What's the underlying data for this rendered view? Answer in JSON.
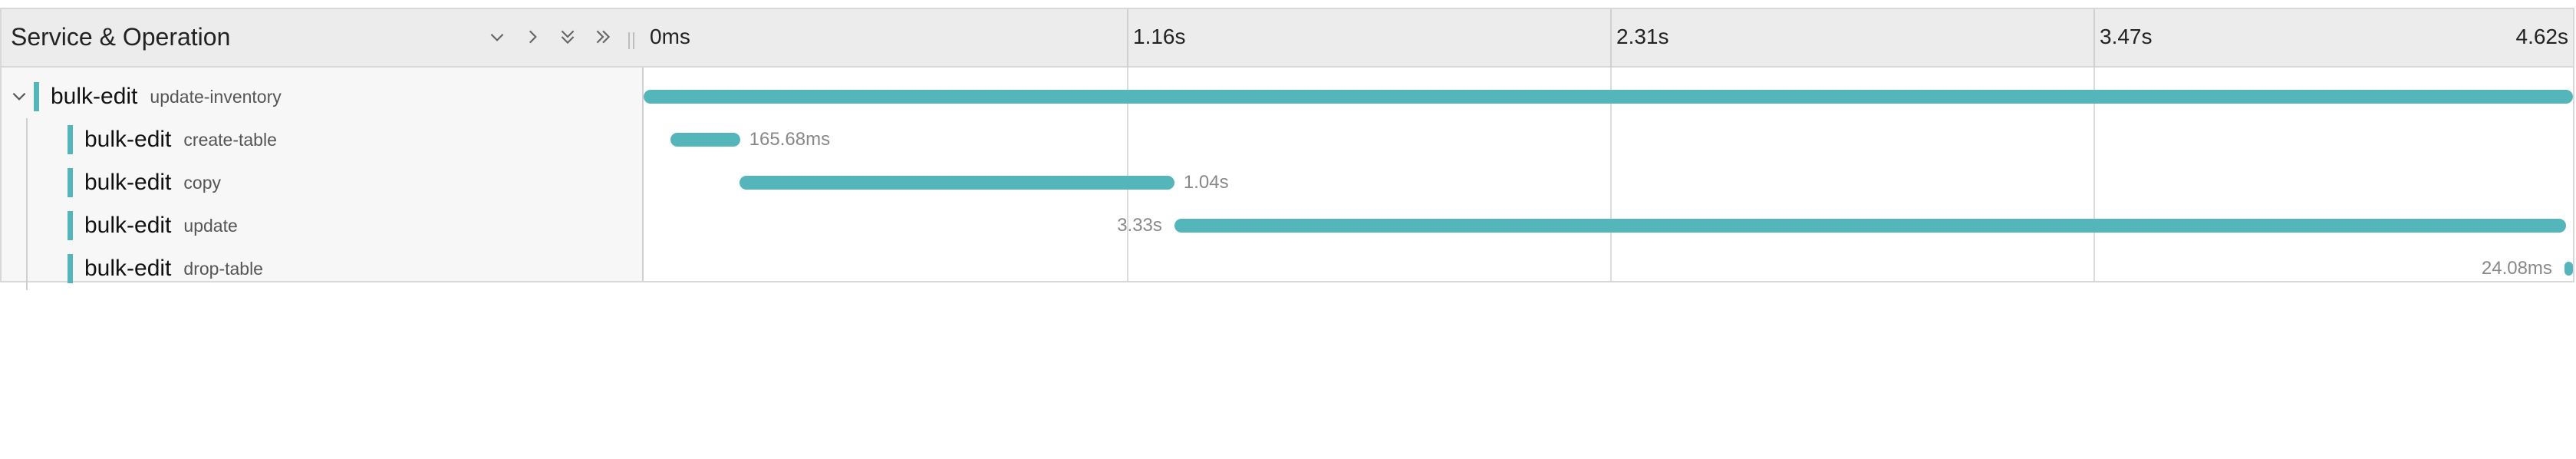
{
  "header": {
    "title": "Service & Operation",
    "ticks": [
      "0ms",
      "1.16s",
      "2.31s",
      "3.47s",
      "4.62s"
    ]
  },
  "colors": {
    "span": "#54b5ba"
  },
  "icons": {
    "collapse_one": "chevron-down-icon",
    "expand_one": "chevron-right-icon",
    "collapse_all": "double-chevron-down-icon",
    "expand_all": "double-chevron-right-icon"
  },
  "spans": [
    {
      "service": "bulk-edit",
      "operation": "update-inventory",
      "depth": 0,
      "start": 0,
      "duration_s": 4.62,
      "duration_label": ""
    },
    {
      "service": "bulk-edit",
      "operation": "create-table",
      "depth": 1,
      "start": 0.065,
      "duration_s": 0.16568,
      "duration_label": "165.68ms"
    },
    {
      "service": "bulk-edit",
      "operation": "copy",
      "depth": 1,
      "start": 0.23,
      "duration_s": 1.04,
      "duration_label": "1.04s"
    },
    {
      "service": "bulk-edit",
      "operation": "update",
      "depth": 1,
      "start": 1.27,
      "duration_s": 3.33,
      "duration_label": "3.33s"
    },
    {
      "service": "bulk-edit",
      "operation": "drop-table",
      "depth": 1,
      "start": 4.596,
      "duration_s": 0.02408,
      "duration_label": "24.08ms"
    }
  ]
}
